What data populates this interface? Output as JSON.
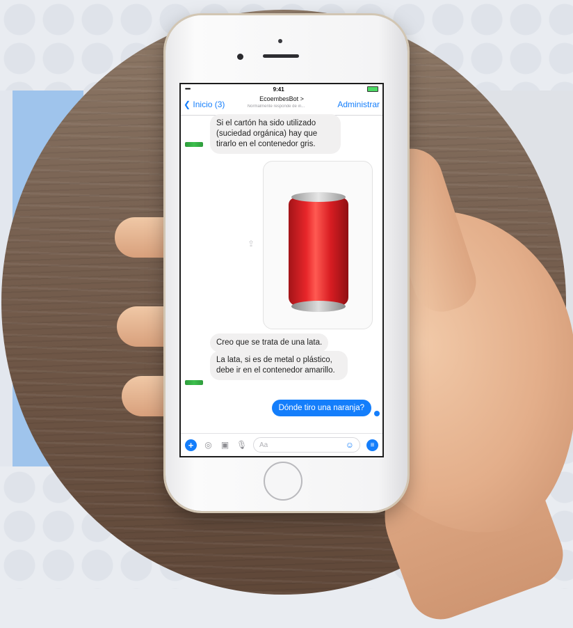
{
  "status_bar": {
    "signal": "•••••",
    "time": "9:41"
  },
  "nav": {
    "back_label": "Inicio (3)",
    "title": "EcoembesBot",
    "title_chevron": ">",
    "subtitle": "Normalmente responde de in...",
    "action_label": "Administrar"
  },
  "messages": [
    {
      "from": "bot",
      "text": "Si el cartón ha sido utilizado (suciedad orgánica) hay que tirarlo en el contenedor gris."
    },
    {
      "from": "user",
      "type": "image",
      "image_desc": "red soda can"
    },
    {
      "from": "bot",
      "text": "Creo que se trata de una lata."
    },
    {
      "from": "bot",
      "text": "La lata, si es de metal o plástico, debe ir en el contenedor amarillo."
    },
    {
      "from": "user",
      "text": "Dónde tiro una naranja?"
    }
  ],
  "composer": {
    "placeholder": "Aa"
  },
  "icons": {
    "back": "chevron-left-icon",
    "plus": "plus-icon",
    "camera": "camera-icon",
    "gallery": "gallery-icon",
    "mic": "microphone-icon",
    "emoji": "emoji-icon",
    "menu": "menu-icon",
    "share": "share-icon"
  },
  "colors": {
    "accent": "#147efb",
    "can": "#e8262a"
  }
}
